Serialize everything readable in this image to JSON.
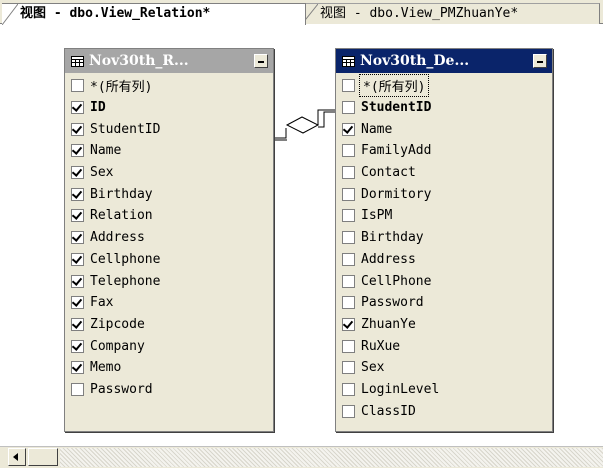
{
  "tabs": [
    {
      "label": "视图 - dbo.View_Relation*",
      "active": true
    },
    {
      "label": "视图 - dbo.View_PMZhuanYe*",
      "active": false
    }
  ],
  "left_table": {
    "title": "Nov30th_R...",
    "columns": [
      {
        "label": "*(所有列)",
        "checked": false,
        "bold": false
      },
      {
        "label": "ID",
        "checked": true,
        "bold": true
      },
      {
        "label": "StudentID",
        "checked": true,
        "bold": false
      },
      {
        "label": "Name",
        "checked": true,
        "bold": false
      },
      {
        "label": "Sex",
        "checked": true,
        "bold": false
      },
      {
        "label": "Birthday",
        "checked": true,
        "bold": false
      },
      {
        "label": "Relation",
        "checked": true,
        "bold": false
      },
      {
        "label": "Address",
        "checked": true,
        "bold": false
      },
      {
        "label": "Cellphone",
        "checked": true,
        "bold": false
      },
      {
        "label": "Telephone",
        "checked": true,
        "bold": false
      },
      {
        "label": "Fax",
        "checked": true,
        "bold": false
      },
      {
        "label": "Zipcode",
        "checked": true,
        "bold": false
      },
      {
        "label": "Company",
        "checked": true,
        "bold": false
      },
      {
        "label": "Memo",
        "checked": true,
        "bold": false
      },
      {
        "label": "Password",
        "checked": false,
        "bold": false
      }
    ]
  },
  "right_table": {
    "title": "Nov30th_De...",
    "columns": [
      {
        "label": "*(所有列)",
        "checked": false,
        "bold": false,
        "focused": true
      },
      {
        "label": "StudentID",
        "checked": false,
        "bold": true
      },
      {
        "label": "Name",
        "checked": true,
        "bold": false
      },
      {
        "label": "FamilyAdd",
        "checked": false,
        "bold": false
      },
      {
        "label": "Contact",
        "checked": false,
        "bold": false
      },
      {
        "label": "Dormitory",
        "checked": false,
        "bold": false
      },
      {
        "label": "IsPM",
        "checked": false,
        "bold": false
      },
      {
        "label": "Birthday",
        "checked": false,
        "bold": false
      },
      {
        "label": "Address",
        "checked": false,
        "bold": false
      },
      {
        "label": "CellPhone",
        "checked": false,
        "bold": false
      },
      {
        "label": "Password",
        "checked": false,
        "bold": false
      },
      {
        "label": "ZhuanYe",
        "checked": true,
        "bold": false
      },
      {
        "label": "RuXue",
        "checked": false,
        "bold": false
      },
      {
        "label": "Sex",
        "checked": false,
        "bold": false
      },
      {
        "label": "LoginLevel",
        "checked": false,
        "bold": false
      },
      {
        "label": "ClassID",
        "checked": false,
        "bold": false
      }
    ]
  },
  "colors": {
    "active_title": "#0a246a",
    "inactive_title": "#a6a6a6",
    "chrome": "#ece9d8"
  },
  "icons": {
    "table": "table-grid-icon",
    "minimize": "minimize-icon",
    "scroll_left": "scroll-left-arrow-icon",
    "join": "join-diamond-icon"
  }
}
